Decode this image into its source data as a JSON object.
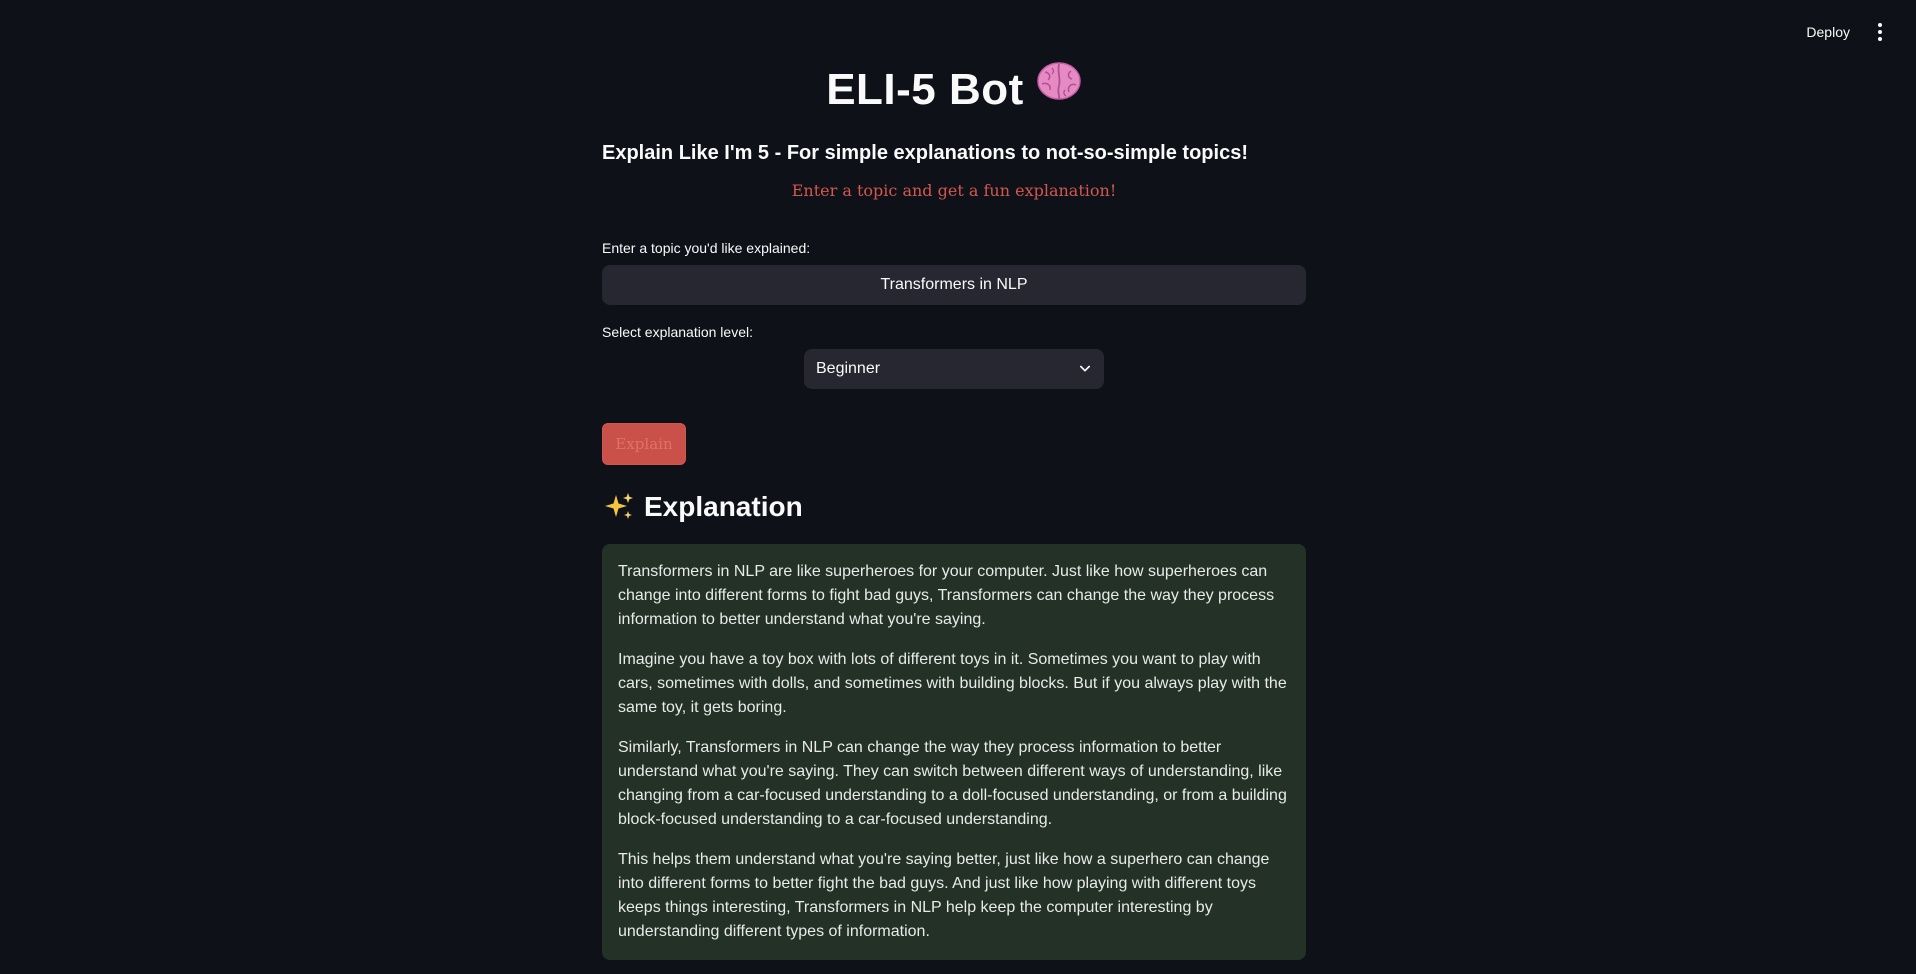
{
  "toolbar": {
    "deploy_label": "Deploy",
    "menu_icon": "more-vertical-icon"
  },
  "header": {
    "title": "ELI-5 Bot",
    "title_icon": "brain-icon",
    "subtitle": "Explain Like I'm 5 - For simple explanations to not-so-simple topics!",
    "tagline": "Enter a topic and get a fun explanation!"
  },
  "form": {
    "topic_label": "Enter a topic you'd like explained:",
    "topic_value": "Transformers in NLP",
    "level_label": "Select explanation level:",
    "level_value": "Beginner",
    "level_icon": "chevron-down-icon",
    "explain_label": "Explain"
  },
  "result": {
    "heading": "Explanation",
    "heading_icon": "sparkles-icon",
    "paragraphs": [
      "Transformers in NLP are like superheroes for your computer. Just like how superheroes can change into different forms to fight bad guys, Transformers can change the way they process information to better understand what you're saying.",
      "Imagine you have a toy box with lots of different toys in it. Sometimes you want to play with cars, sometimes with dolls, and sometimes with building blocks. But if you always play with the same toy, it gets boring.",
      "Similarly, Transformers in NLP can change the way they process information to better understand what you're saying. They can switch between different ways of understanding, like changing from a car-focused understanding to a doll-focused understanding, or from a building block-focused understanding to a car-focused understanding.",
      "This helps them understand what you're saying better, just like how a superhero can change into different forms to better fight the bad guys. And just like how playing with different toys keeps things interesting, Transformers in NLP help keep the computer interesting by understanding different types of information."
    ]
  },
  "colors": {
    "background": "#0e1117",
    "accent": "#d2584f",
    "input_bg": "#262730",
    "success_box": "#233126"
  }
}
